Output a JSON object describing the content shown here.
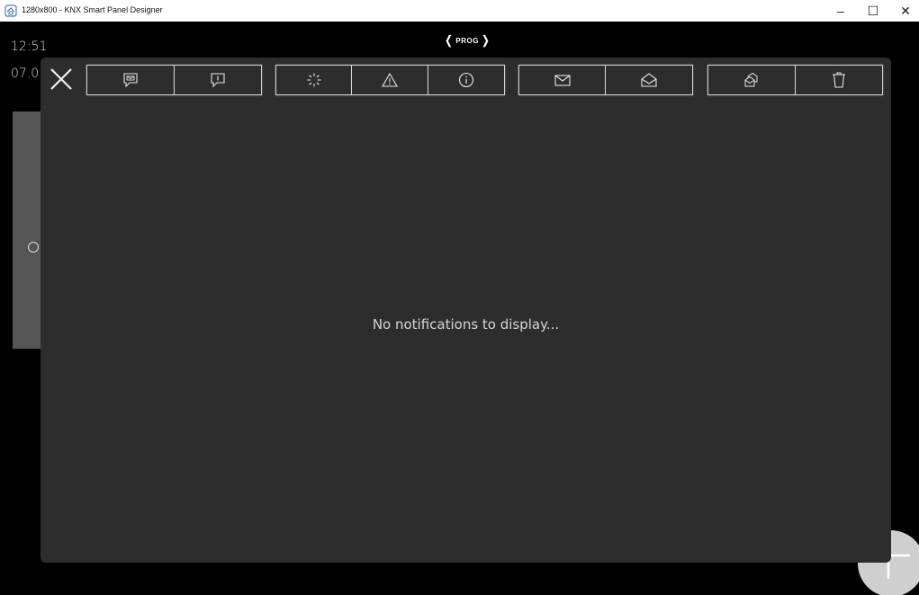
{
  "window": {
    "title": "1280x800 - KNX Smart Panel Designer",
    "minimize_glyph": "–",
    "maximize_glyph": "☐",
    "close_glyph": "✕"
  },
  "panel": {
    "clock": "12:51",
    "date": "07.0",
    "prog_label": "PROG",
    "prog_left": "❬",
    "prog_right": "❭"
  },
  "notifications": {
    "empty_message": "No notifications to display...",
    "filter_icons": [
      "message-icon",
      "info-message-icon",
      "spinner-icon",
      "warning-icon",
      "info-icon",
      "unread-mail-icon",
      "open-mail-icon",
      "mark-all-read-icon",
      "delete-icon"
    ]
  },
  "colors": {
    "panel_bg": "#000000",
    "dialog_bg": "#2d2d2d",
    "button_border": "#d4d4d4",
    "text": "#d5d5d5"
  }
}
